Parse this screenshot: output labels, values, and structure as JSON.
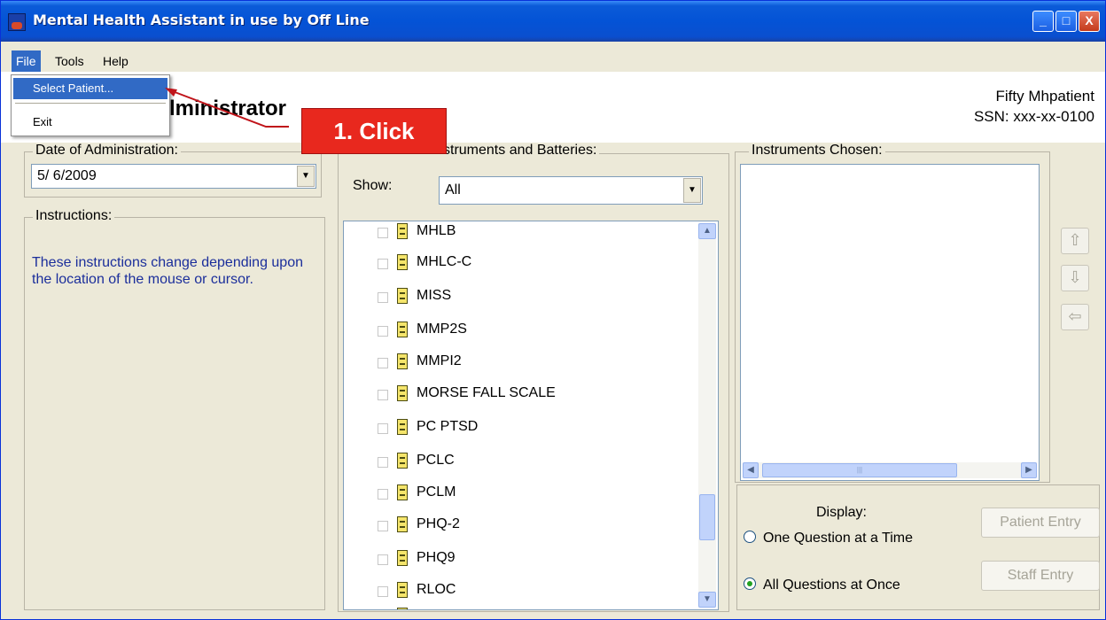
{
  "window": {
    "title": "Mental Health Assistant in use by Off Line",
    "controls": {
      "minimize": "_",
      "maximize": "□",
      "close": "X"
    }
  },
  "menubar": {
    "items": [
      {
        "label": "File",
        "active": true
      },
      {
        "label": "Tools"
      },
      {
        "label": "Help"
      }
    ]
  },
  "file_menu": {
    "items": [
      {
        "label": "Select Patient...",
        "highlighted": true
      },
      {
        "label": "Exit"
      }
    ]
  },
  "header": {
    "title": "Administrator",
    "title_visible": "lministrator",
    "patient_name": "Fifty Mhpatient",
    "patient_ssn": "SSN: xxx-xx-0100"
  },
  "date_group": {
    "label": "Date of Administration:",
    "value": "5/ 6/2009"
  },
  "instructions": {
    "label": "Instructions:",
    "text": "These instructions change depending upon the location of the mouse or cursor."
  },
  "instruments_group": {
    "label": "struments and Batteries:",
    "show_label": "Show:",
    "show_value": "All",
    "items": [
      {
        "label": "MHLB",
        "checked": false
      },
      {
        "label": "MHLC-C",
        "checked": false
      },
      {
        "label": "MISS",
        "checked": false
      },
      {
        "label": "MMP2S",
        "checked": false
      },
      {
        "label": "MMPI2",
        "checked": false
      },
      {
        "label": "MORSE FALL SCALE",
        "checked": false
      },
      {
        "label": "PC PTSD",
        "checked": false
      },
      {
        "label": "PCLC",
        "checked": false
      },
      {
        "label": "PCLM",
        "checked": false
      },
      {
        "label": "PHQ-2",
        "checked": false
      },
      {
        "label": "PHQ9",
        "checked": false
      },
      {
        "label": "RLOC",
        "checked": false
      }
    ]
  },
  "chosen_group": {
    "label": "Instruments Chosen:"
  },
  "display": {
    "label": "Display:",
    "options": [
      {
        "label": "One Question at a Time",
        "checked": false
      },
      {
        "label": "All Questions at Once",
        "checked": true
      }
    ],
    "patient_entry": "Patient Entry",
    "staff_entry": "Staff Entry"
  },
  "callout": {
    "text": "1. Click",
    "color": "#e8281e"
  }
}
